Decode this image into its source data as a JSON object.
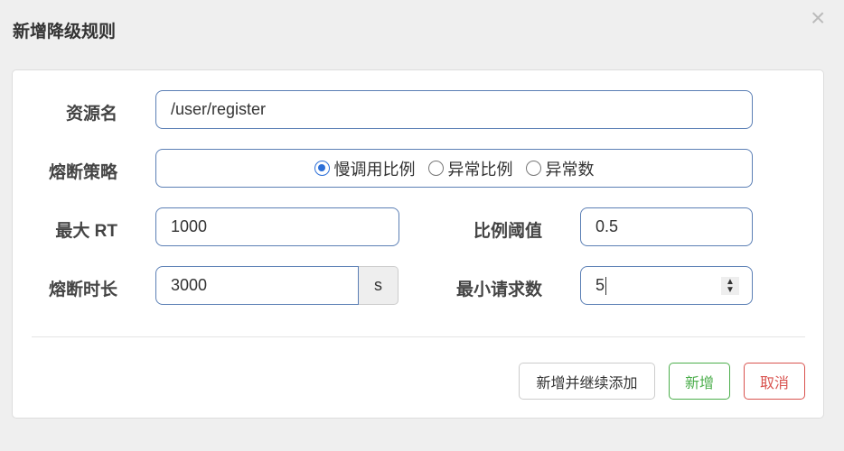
{
  "dialog": {
    "title": "新增降级规则",
    "close": "×"
  },
  "form": {
    "resource_label": "资源名",
    "resource_value": "/user/register",
    "strategy_label": "熔断策略",
    "strategy_options": [
      {
        "label": "慢调用比例",
        "selected": true
      },
      {
        "label": "异常比例",
        "selected": false
      },
      {
        "label": "异常数",
        "selected": false
      }
    ],
    "max_rt_label": "最大 RT",
    "max_rt_value": "1000",
    "ratio_label": "比例阈值",
    "ratio_value": "0.5",
    "duration_label": "熔断时长",
    "duration_value": "3000",
    "duration_unit": "s",
    "min_req_label": "最小请求数",
    "min_req_value": "5"
  },
  "buttons": {
    "add_continue": "新增并继续添加",
    "add": "新增",
    "cancel": "取消"
  },
  "colors": {
    "add": "#4cae4c",
    "cancel": "#d9534f",
    "focus": "#5b7fb5"
  }
}
